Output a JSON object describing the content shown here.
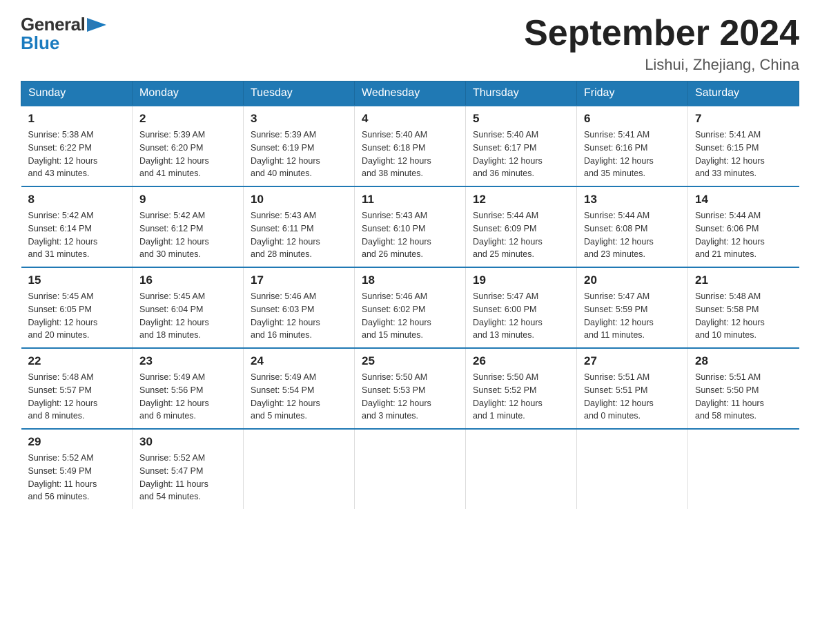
{
  "header": {
    "logo_general": "General",
    "logo_blue": "Blue",
    "title": "September 2024",
    "subtitle": "Lishui, Zhejiang, China"
  },
  "weekdays": [
    "Sunday",
    "Monday",
    "Tuesday",
    "Wednesday",
    "Thursday",
    "Friday",
    "Saturday"
  ],
  "weeks": [
    [
      {
        "day": "1",
        "sunrise": "5:38 AM",
        "sunset": "6:22 PM",
        "daylight": "12 hours and 43 minutes."
      },
      {
        "day": "2",
        "sunrise": "5:39 AM",
        "sunset": "6:20 PM",
        "daylight": "12 hours and 41 minutes."
      },
      {
        "day": "3",
        "sunrise": "5:39 AM",
        "sunset": "6:19 PM",
        "daylight": "12 hours and 40 minutes."
      },
      {
        "day": "4",
        "sunrise": "5:40 AM",
        "sunset": "6:18 PM",
        "daylight": "12 hours and 38 minutes."
      },
      {
        "day": "5",
        "sunrise": "5:40 AM",
        "sunset": "6:17 PM",
        "daylight": "12 hours and 36 minutes."
      },
      {
        "day": "6",
        "sunrise": "5:41 AM",
        "sunset": "6:16 PM",
        "daylight": "12 hours and 35 minutes."
      },
      {
        "day": "7",
        "sunrise": "5:41 AM",
        "sunset": "6:15 PM",
        "daylight": "12 hours and 33 minutes."
      }
    ],
    [
      {
        "day": "8",
        "sunrise": "5:42 AM",
        "sunset": "6:14 PM",
        "daylight": "12 hours and 31 minutes."
      },
      {
        "day": "9",
        "sunrise": "5:42 AM",
        "sunset": "6:12 PM",
        "daylight": "12 hours and 30 minutes."
      },
      {
        "day": "10",
        "sunrise": "5:43 AM",
        "sunset": "6:11 PM",
        "daylight": "12 hours and 28 minutes."
      },
      {
        "day": "11",
        "sunrise": "5:43 AM",
        "sunset": "6:10 PM",
        "daylight": "12 hours and 26 minutes."
      },
      {
        "day": "12",
        "sunrise": "5:44 AM",
        "sunset": "6:09 PM",
        "daylight": "12 hours and 25 minutes."
      },
      {
        "day": "13",
        "sunrise": "5:44 AM",
        "sunset": "6:08 PM",
        "daylight": "12 hours and 23 minutes."
      },
      {
        "day": "14",
        "sunrise": "5:44 AM",
        "sunset": "6:06 PM",
        "daylight": "12 hours and 21 minutes."
      }
    ],
    [
      {
        "day": "15",
        "sunrise": "5:45 AM",
        "sunset": "6:05 PM",
        "daylight": "12 hours and 20 minutes."
      },
      {
        "day": "16",
        "sunrise": "5:45 AM",
        "sunset": "6:04 PM",
        "daylight": "12 hours and 18 minutes."
      },
      {
        "day": "17",
        "sunrise": "5:46 AM",
        "sunset": "6:03 PM",
        "daylight": "12 hours and 16 minutes."
      },
      {
        "day": "18",
        "sunrise": "5:46 AM",
        "sunset": "6:02 PM",
        "daylight": "12 hours and 15 minutes."
      },
      {
        "day": "19",
        "sunrise": "5:47 AM",
        "sunset": "6:00 PM",
        "daylight": "12 hours and 13 minutes."
      },
      {
        "day": "20",
        "sunrise": "5:47 AM",
        "sunset": "5:59 PM",
        "daylight": "12 hours and 11 minutes."
      },
      {
        "day": "21",
        "sunrise": "5:48 AM",
        "sunset": "5:58 PM",
        "daylight": "12 hours and 10 minutes."
      }
    ],
    [
      {
        "day": "22",
        "sunrise": "5:48 AM",
        "sunset": "5:57 PM",
        "daylight": "12 hours and 8 minutes."
      },
      {
        "day": "23",
        "sunrise": "5:49 AM",
        "sunset": "5:56 PM",
        "daylight": "12 hours and 6 minutes."
      },
      {
        "day": "24",
        "sunrise": "5:49 AM",
        "sunset": "5:54 PM",
        "daylight": "12 hours and 5 minutes."
      },
      {
        "day": "25",
        "sunrise": "5:50 AM",
        "sunset": "5:53 PM",
        "daylight": "12 hours and 3 minutes."
      },
      {
        "day": "26",
        "sunrise": "5:50 AM",
        "sunset": "5:52 PM",
        "daylight": "12 hours and 1 minute."
      },
      {
        "day": "27",
        "sunrise": "5:51 AM",
        "sunset": "5:51 PM",
        "daylight": "12 hours and 0 minutes."
      },
      {
        "day": "28",
        "sunrise": "5:51 AM",
        "sunset": "5:50 PM",
        "daylight": "11 hours and 58 minutes."
      }
    ],
    [
      {
        "day": "29",
        "sunrise": "5:52 AM",
        "sunset": "5:49 PM",
        "daylight": "11 hours and 56 minutes."
      },
      {
        "day": "30",
        "sunrise": "5:52 AM",
        "sunset": "5:47 PM",
        "daylight": "11 hours and 54 minutes."
      },
      null,
      null,
      null,
      null,
      null
    ]
  ],
  "labels": {
    "sunrise": "Sunrise:",
    "sunset": "Sunset:",
    "daylight": "Daylight:"
  }
}
